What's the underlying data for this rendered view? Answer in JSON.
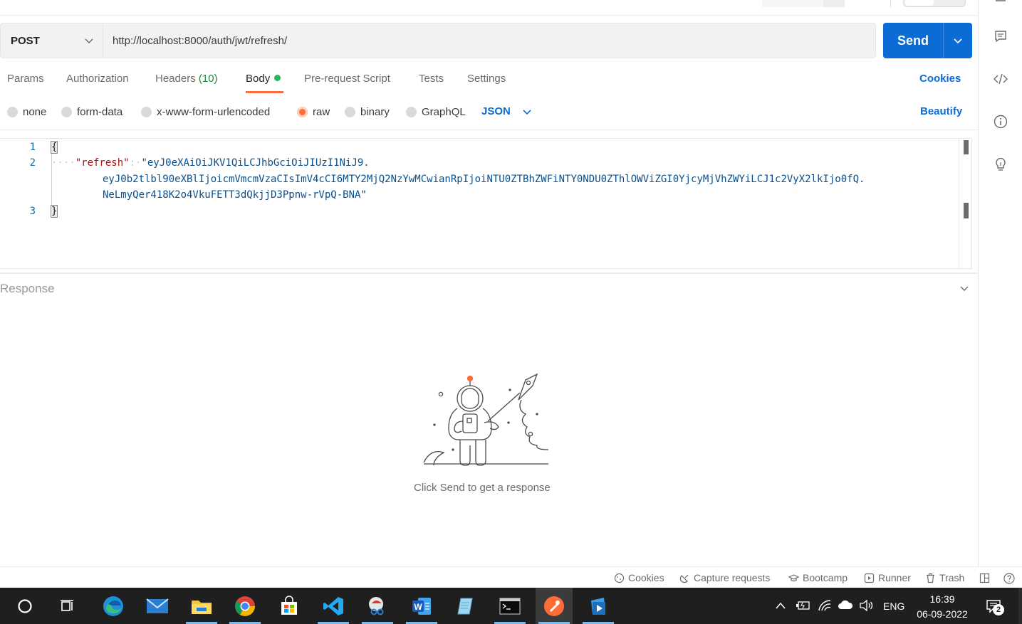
{
  "request": {
    "method": "POST",
    "url": "http://localhost:8000/auth/jwt/refresh/",
    "send_label": "Send"
  },
  "tabs": [
    {
      "label": "Params"
    },
    {
      "label": "Authorization"
    },
    {
      "label": "Headers",
      "count": "(10)"
    },
    {
      "label": "Body",
      "active": true
    },
    {
      "label": "Pre-request Script"
    },
    {
      "label": "Tests"
    },
    {
      "label": "Settings"
    }
  ],
  "cookies_link": "Cookies",
  "body_types": {
    "options": [
      "none",
      "form-data",
      "x-www-form-urlencoded",
      "raw",
      "binary",
      "GraphQL"
    ],
    "selected": "raw",
    "format": "JSON",
    "beautify_label": "Beautify"
  },
  "editor": {
    "line_numbers": [
      "1",
      "2",
      "3"
    ],
    "open_brace": "{",
    "close_brace": "}",
    "indent": "····",
    "key": "\"refresh\"",
    "colon": ":·",
    "value_part1": "\"eyJ0eXAiOiJKV1QiLCJhbGciOiJIUzI1NiJ9.",
    "value_part2": "eyJ0b2tlbl90eXBlIjoicmVmcmVzaCIsImV4cCI6MTY2MjQ2NzYwMCwianRpIjoiNTU0ZTBhZWFiNTY0NDU0ZThlOWViZGI0YjcyMjVhZWYiLCJ1c2VyX2lkIjo0fQ.",
    "value_part3": "NeLmyQer418K2o4VkuFETT3dQkjjD3Ppnw-rVpQ-BNA\""
  },
  "response": {
    "title": "Response",
    "empty_message": "Click Send to get a response"
  },
  "statusbar": {
    "cookies": "Cookies",
    "capture": "Capture requests",
    "bootcamp": "Bootcamp",
    "runner": "Runner",
    "trash": "Trash"
  },
  "taskbar": {
    "language": "ENG",
    "time": "16:39",
    "date": "06-09-2022",
    "notifications": "2"
  },
  "colors": {
    "accent_blue": "#0c6cd6",
    "postman_orange": "#ff6c37",
    "body_dot_green": "#26b561"
  }
}
